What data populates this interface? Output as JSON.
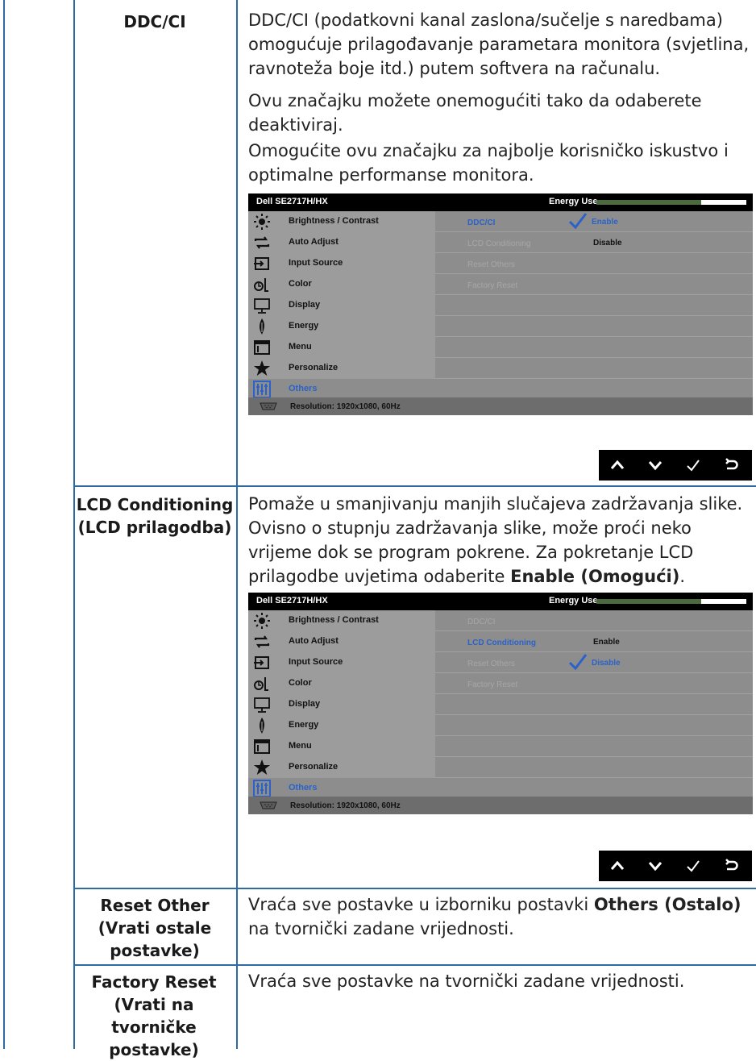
{
  "rows": [
    {
      "label": "DDC/CI",
      "paragraphs": [
        "DDC/CI (podatkovni kanal zaslona/sučelje s naredbama) omogućuje prilagođavanje parametara monitora (svjetlina, ravnoteža boje itd.) putem softvera na računalu.",
        "Ovu značajku možete onemogućiti tako da odaberete deaktiviraj.",
        "Omogućite ovu značajku za najbolje korisničko iskustvo i optimalne performanse monitora."
      ]
    },
    {
      "label": "LCD Conditioning (LCD prilagodba)",
      "paragraph_parts": [
        "Pomaže u smanjivanju manjih slučajeva zadržavanja slike. Ovisno o stupnju zadržavanja slike, može proći neko vrijeme dok se program pokrene. Za pokretanje LCD prilagodbe uvjetima odaberite ",
        "Enable (Omogući)",
        "."
      ]
    },
    {
      "label": "Reset Other (Vrati ostale postavke)",
      "paragraph_parts": [
        "Vraća sve postavke u izborniku postavki ",
        "Others (Ostalo)",
        " na tvornički zadane vrijednosti."
      ]
    },
    {
      "label": "Factory Reset (Vrati na tvorničke postavke)",
      "paragraph": "Vraća sve postavke na tvornički zadane vrijednosti."
    }
  ],
  "osd": {
    "model": "Dell SE2717H/HX",
    "energy_label": "Energy Use",
    "energy_level": 0.7,
    "menu_items": [
      {
        "label": "Brightness / Contrast",
        "icon": "brightness-icon"
      },
      {
        "label": "Auto Adjust",
        "icon": "auto-adjust-icon"
      },
      {
        "label": "Input Source",
        "icon": "input-source-icon"
      },
      {
        "label": "Color",
        "icon": "color-icon"
      },
      {
        "label": "Display",
        "icon": "display-icon"
      },
      {
        "label": "Energy",
        "icon": "energy-icon"
      },
      {
        "label": "Menu",
        "icon": "menu-icon"
      },
      {
        "label": "Personalize",
        "icon": "star-icon"
      },
      {
        "label": "Others",
        "icon": "others-icon"
      }
    ],
    "selected_menu": "Others",
    "submenu": [
      "DDC/CI",
      "LCD Conditioning",
      "Reset Others",
      "Factory Reset"
    ],
    "resolution": "Resolution: 1920x1080, 60Hz"
  },
  "osd1": {
    "active_item": "DDC/CI",
    "option1": "Enable",
    "option2": "Disable",
    "checked": "Enable"
  },
  "osd2": {
    "active_item": "LCD Conditioning",
    "option1": "Enable",
    "option2": "Disable",
    "checked": "Disable"
  },
  "nav_buttons": [
    "up-icon",
    "down-icon",
    "check-icon",
    "back-icon"
  ],
  "colors": {
    "rule": "#2e6aa3",
    "osd_highlight": "#2a62c9",
    "energy_fill": "#4c6a40"
  }
}
